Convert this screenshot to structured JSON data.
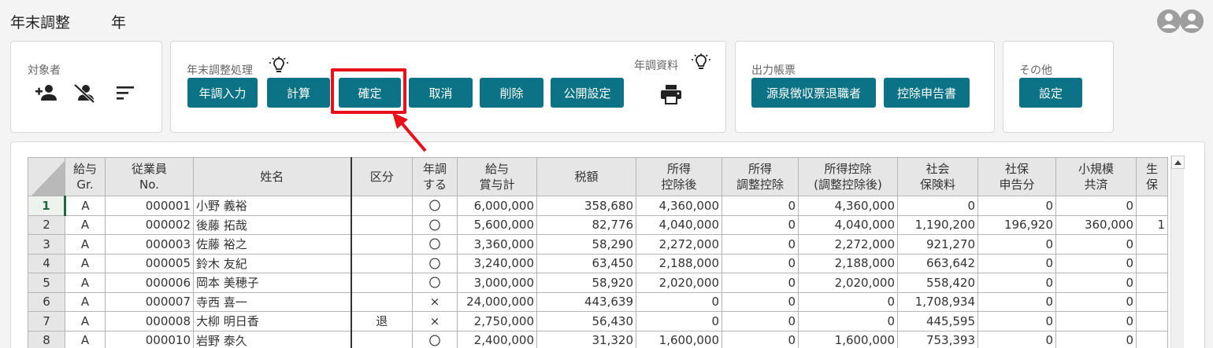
{
  "header": {
    "title_prefix": "年末調整",
    "title_suffix": "年"
  },
  "panels": {
    "target": {
      "label": "対象者",
      "icons": [
        "person-add-icon",
        "person-off-icon",
        "sort-icon"
      ]
    },
    "processing": {
      "label": "年末調整処理",
      "buttons": [
        "年調入力",
        "計算",
        "確定",
        "取消",
        "削除",
        "公開設定"
      ],
      "docs_label": "年調資料"
    },
    "output": {
      "label": "出力帳票",
      "buttons": [
        "源泉徴収票退職者",
        "控除申告書"
      ]
    },
    "other": {
      "label": "その他",
      "buttons": [
        "設定"
      ]
    }
  },
  "colors": {
    "button": "#0b7385",
    "highlight": "#e8101a",
    "selected_row": "#1e6b3c"
  },
  "table": {
    "headers": [
      "給与\nGr.",
      "従業員\nNo.",
      "姓名",
      "区分",
      "年調\nする",
      "給与\n賞与計",
      "税額",
      "所得\n控除後",
      "所得\n調整控除",
      "所得控除\n(調整控除後)",
      "社会\n保険料",
      "社保\n申告分",
      "小規模\n共済",
      "生\n保"
    ],
    "rows": [
      [
        "1",
        "A",
        "000001",
        "小野 義裕",
        "",
        "〇",
        "6,000,000",
        "358,680",
        "4,360,000",
        "0",
        "4,360,000",
        "0",
        "0",
        "0",
        ""
      ],
      [
        "2",
        "A",
        "000002",
        "後藤 拓哉",
        "",
        "〇",
        "5,600,000",
        "82,776",
        "4,040,000",
        "0",
        "4,040,000",
        "1,190,200",
        "196,920",
        "360,000",
        "1"
      ],
      [
        "3",
        "A",
        "000003",
        "佐藤 裕之",
        "",
        "〇",
        "3,360,000",
        "58,290",
        "2,272,000",
        "0",
        "2,272,000",
        "921,270",
        "0",
        "0",
        ""
      ],
      [
        "4",
        "A",
        "000005",
        "鈴木 友紀",
        "",
        "〇",
        "3,240,000",
        "63,450",
        "2,188,000",
        "0",
        "2,188,000",
        "663,642",
        "0",
        "0",
        ""
      ],
      [
        "5",
        "A",
        "000006",
        "岡本 美穂子",
        "",
        "〇",
        "3,000,000",
        "58,920",
        "2,020,000",
        "0",
        "2,020,000",
        "558,420",
        "0",
        "0",
        ""
      ],
      [
        "6",
        "A",
        "000007",
        "寺西 喜一",
        "",
        "×",
        "24,000,000",
        "443,639",
        "0",
        "0",
        "0",
        "1,708,934",
        "0",
        "0",
        ""
      ],
      [
        "7",
        "A",
        "000008",
        "大柳 明日香",
        "退",
        "×",
        "2,750,000",
        "56,430",
        "0",
        "0",
        "0",
        "445,595",
        "0",
        "0",
        ""
      ],
      [
        "8",
        "A",
        "000010",
        "岩野 泰久",
        "",
        "〇",
        "2,400,000",
        "31,320",
        "1,600,000",
        "0",
        "1,600,000",
        "753,393",
        "0",
        "0",
        ""
      ]
    ]
  }
}
